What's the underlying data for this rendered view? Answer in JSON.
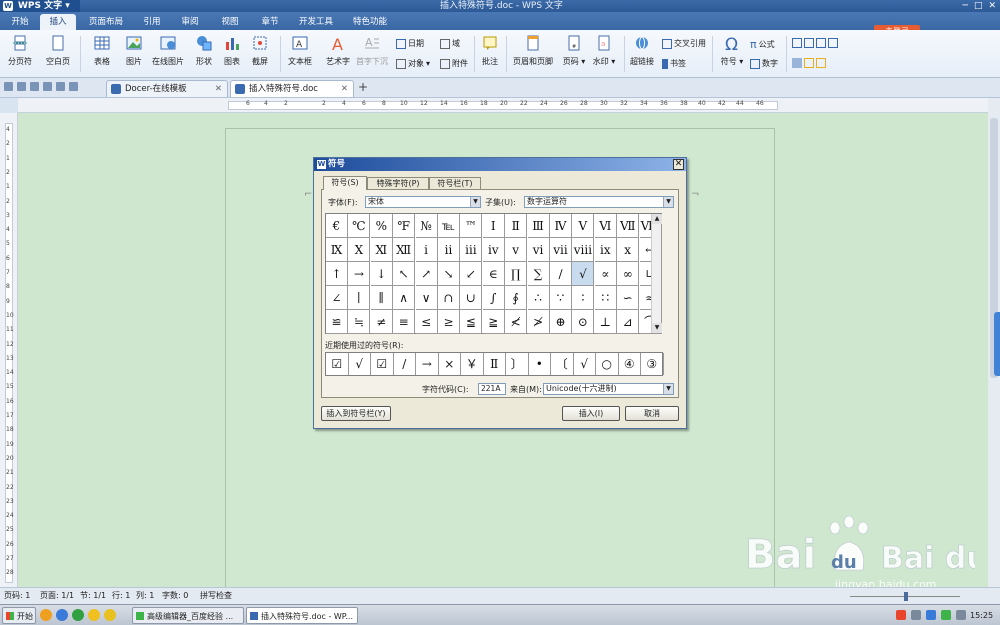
{
  "app": {
    "name": "WPS 文字",
    "doc_title": "插入特殊符号.doc - WPS 文字",
    "login": "未登录"
  },
  "menu": [
    "开始",
    "插入",
    "页面布局",
    "引用",
    "审阅",
    "视图",
    "章节",
    "开发工具",
    "特色功能"
  ],
  "menu_active": 1,
  "ribbon": {
    "large": [
      "分页符",
      "空白页",
      "表格",
      "图片",
      "在线图片",
      "形状",
      "图表",
      "截屏",
      "文本框",
      "艺术字",
      "首字下沉",
      "批注",
      "页眉和页脚",
      "页码",
      "水印",
      "超链接",
      "符号"
    ],
    "small": [
      "日期",
      "域",
      "对象",
      "附件",
      "交叉引用",
      "书签",
      "公式",
      "数字"
    ]
  },
  "tabs": [
    "Docer-在线模板",
    "插入特殊符号.doc"
  ],
  "ruler_numbers": [
    "6",
    "4",
    "2",
    "2",
    "4",
    "6",
    "8",
    "10",
    "12",
    "14",
    "16",
    "18",
    "20",
    "22",
    "24",
    "26",
    "28",
    "30",
    "32",
    "34",
    "36",
    "38",
    "40",
    "42",
    "44",
    "46"
  ],
  "ruler_v_numbers": [
    "4",
    "2",
    "1",
    "2",
    "1",
    "2",
    "3",
    "4",
    "5",
    "6",
    "7",
    "8",
    "9",
    "10",
    "11",
    "12",
    "13",
    "14",
    "15",
    "16",
    "17",
    "18",
    "19",
    "20",
    "21",
    "22",
    "23",
    "24",
    "25",
    "26",
    "27",
    "28"
  ],
  "dialog": {
    "title": "符号",
    "tabs": [
      "符号(S)",
      "特殊字符(P)",
      "符号栏(T)"
    ],
    "font_label": "字体(F):",
    "font_value": "宋体",
    "subset_label": "子集(U):",
    "subset_value": "数字运算符",
    "symbols": [
      [
        "€",
        "℃",
        "%",
        "℉",
        "№",
        "℡",
        "™",
        "Ⅰ",
        "Ⅱ",
        "Ⅲ",
        "Ⅳ",
        "Ⅴ",
        "Ⅵ",
        "Ⅶ",
        "Ⅷ"
      ],
      [
        "Ⅸ",
        "Ⅹ",
        "Ⅺ",
        "Ⅻ",
        "ⅰ",
        "ⅱ",
        "ⅲ",
        "ⅳ",
        "ⅴ",
        "ⅵ",
        "ⅶ",
        "ⅷ",
        "ⅸ",
        "ⅹ",
        "←"
      ],
      [
        "↑",
        "→",
        "↓",
        "↖",
        "↗",
        "↘",
        "↙",
        "∈",
        "∏",
        "∑",
        "∕",
        "√",
        "∝",
        "∞",
        "∟"
      ],
      [
        "∠",
        "∣",
        "∥",
        "∧",
        "∨",
        "∩",
        "∪",
        "∫",
        "∮",
        "∴",
        "∵",
        "∶",
        "∷",
        "∽",
        "≈"
      ],
      [
        "≌",
        "≒",
        "≠",
        "≡",
        "≤",
        "≥",
        "≦",
        "≧",
        "≮",
        "≯",
        "⊕",
        "⊙",
        "⊥",
        "⊿",
        "⌒"
      ]
    ],
    "selected": {
      "row": 2,
      "col": 11
    },
    "recent_label": "近期使用过的符号(R):",
    "recent": [
      "☑",
      "√",
      "☑",
      "/",
      "→",
      "×",
      "￥",
      "Ⅱ",
      "〕",
      "•",
      "〔",
      "√",
      "○",
      "④",
      "③"
    ],
    "code_label": "字符代码(C):",
    "code_value": "221A",
    "from_label": "来自(M):",
    "from_value": "Unicode(十六进制)",
    "btn_toolbar": "插入到符号栏(Y)",
    "btn_insert": "插入(I)",
    "btn_cancel": "取消"
  },
  "status": {
    "page": "页码: 1",
    "pages": "页面: 1/1",
    "section": "节: 1/1",
    "line": "行: 1",
    "col": "列: 1",
    "words": "字数: 0",
    "spell": "拼写检查"
  },
  "taskbar": {
    "start": "开始",
    "tasks": [
      "高级编辑器_百度经验 ...",
      "插入特殊符号.doc - WP..."
    ],
    "time": "15:25"
  },
  "watermark": {
    "text": "Bai du 经验",
    "url": "jingyan.baidu.com"
  }
}
